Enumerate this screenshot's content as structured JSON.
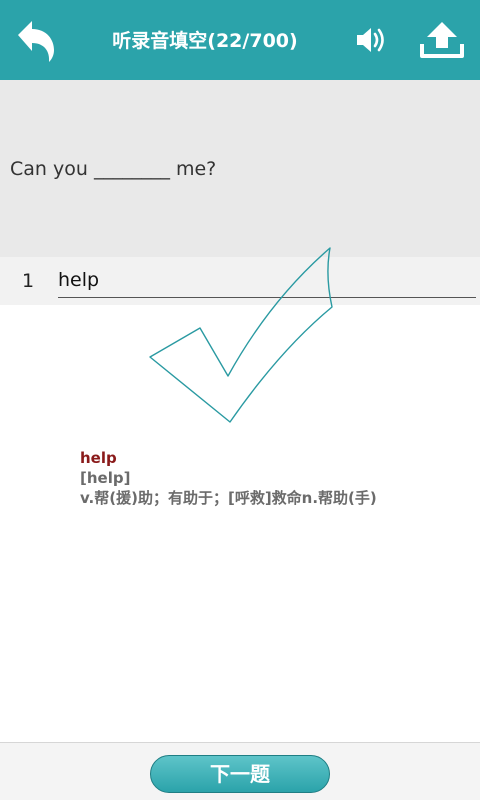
{
  "header": {
    "title": "听录音填空(22/700)",
    "background_color": "#2ba3aa",
    "icons": [
      "back-arrow-icon",
      "speaker-icon",
      "upload-icon"
    ]
  },
  "question": {
    "text": "Can you ________ me?"
  },
  "answer": {
    "number": "1",
    "value": "help"
  },
  "result": {
    "icon": "checkmark-icon",
    "word": "help",
    "phonetic": "[help]",
    "meaning": "v.帮(援)助；有助于；[呼救]救命n.帮助(手)"
  },
  "footer": {
    "next_label": "下一题"
  }
}
